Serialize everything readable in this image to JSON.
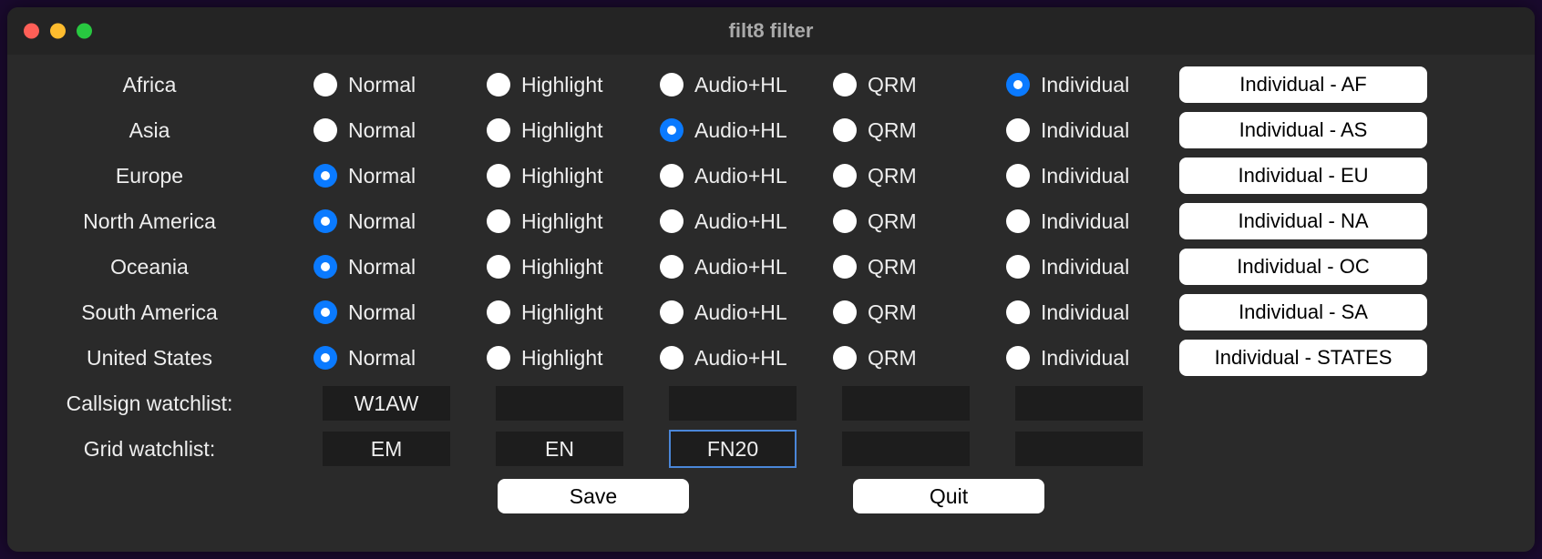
{
  "window": {
    "title": "filt8 filter"
  },
  "options": {
    "normal": "Normal",
    "highlight": "Highlight",
    "audio_hl": "Audio+HL",
    "qrm": "QRM",
    "individual": "Individual"
  },
  "regions": [
    {
      "name": "Africa",
      "selected": "individual",
      "button": "Individual - AF"
    },
    {
      "name": "Asia",
      "selected": "audio_hl",
      "button": "Individual - AS"
    },
    {
      "name": "Europe",
      "selected": "normal",
      "button": "Individual - EU"
    },
    {
      "name": "North America",
      "selected": "normal",
      "button": "Individual - NA"
    },
    {
      "name": "Oceania",
      "selected": "normal",
      "button": "Individual - OC"
    },
    {
      "name": "South America",
      "selected": "normal",
      "button": "Individual - SA"
    },
    {
      "name": "United States",
      "selected": "normal",
      "button": "Individual - STATES"
    }
  ],
  "watchlists": {
    "callsign": {
      "label": "Callsign watchlist:",
      "values": [
        "W1AW",
        "",
        "",
        "",
        ""
      ],
      "focused": -1
    },
    "grid": {
      "label": "Grid watchlist:",
      "values": [
        "EM",
        "EN",
        "FN20",
        "",
        ""
      ],
      "focused": 2
    }
  },
  "buttons": {
    "save": "Save",
    "quit": "Quit"
  }
}
